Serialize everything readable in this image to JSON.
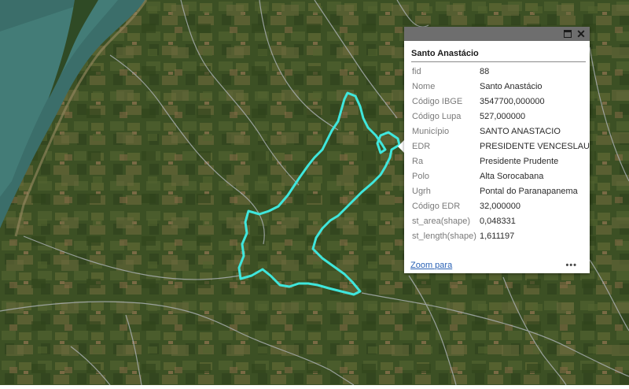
{
  "map": {
    "region_color": "#3fe6dc",
    "colors": {
      "land": "#3c4f26",
      "water": "#3b6e6a",
      "boundary": "#a8aeb0"
    }
  },
  "popup": {
    "title": "Santo Anastácio",
    "attributes": [
      {
        "field": "fid",
        "value": "88"
      },
      {
        "field": "Nome",
        "value": "Santo Anastácio"
      },
      {
        "field": "Código IBGE",
        "value": "3547700,000000"
      },
      {
        "field": "Código Lupa",
        "value": "527,000000"
      },
      {
        "field": "Município",
        "value": "SANTO ANASTACIO"
      },
      {
        "field": "EDR",
        "value": "PRESIDENTE VENCESLAU"
      },
      {
        "field": "Ra",
        "value": "Presidente Prudente"
      },
      {
        "field": "Polo",
        "value": "Alta Sorocabana"
      },
      {
        "field": "Ugrh",
        "value": "Pontal do Paranapanema"
      },
      {
        "field": "Código EDR",
        "value": "32,000000"
      },
      {
        "field": "st_area(shape)",
        "value": "0,048331"
      },
      {
        "field": "st_length(shape)",
        "value": "1,611197"
      }
    ],
    "zoom_label": "Zoom para",
    "more_label": "•••",
    "maximize_icon": "maximize-icon",
    "close_icon": "close-icon",
    "close_glyph": "✕"
  }
}
